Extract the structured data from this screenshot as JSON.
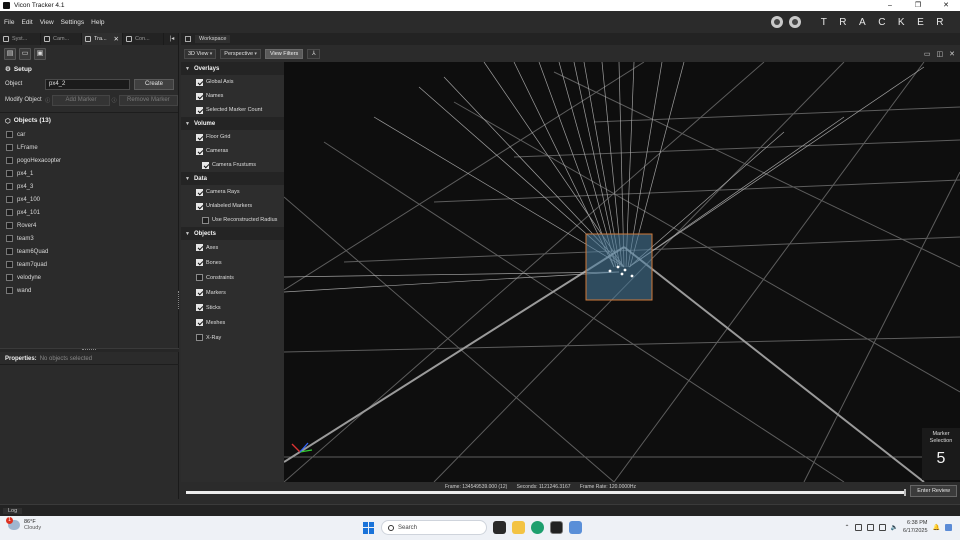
{
  "window": {
    "title": "Vicon Tracker 4.1",
    "minimize": "–",
    "maximize": "❐",
    "close": "✕"
  },
  "menu": [
    "File",
    "Edit",
    "View",
    "Settings",
    "Help"
  ],
  "brand": "TRACKER",
  "left_tabs": [
    {
      "label": "Syst...",
      "icon": "gear-icon"
    },
    {
      "label": "Cam...",
      "icon": "camera-icon"
    },
    {
      "label": "Tra...",
      "icon": "target-icon",
      "close": "✕"
    },
    {
      "label": "Con...",
      "icon": "wrench-icon"
    }
  ],
  "setup": {
    "title": "Setup",
    "object_label": "Object",
    "object_value": "px4_2",
    "create_label": "Create",
    "modify_label": "Modify Object",
    "add_marker": "Add Marker",
    "remove_marker": "Remove Marker"
  },
  "objects": {
    "title": "Objects (13)",
    "items": [
      "car",
      "LFrame",
      "pogoHexacopter",
      "px4_1",
      "px4_3",
      "px4_100",
      "px4_101",
      "Rover4",
      "team3",
      "team6Quad",
      "team7quad",
      "velodyne",
      "wand"
    ]
  },
  "properties": {
    "title": "Properties:",
    "subtitle": "No objects selected"
  },
  "workspace": {
    "tab": "Workspace",
    "view_mode": "3D View",
    "camera_mode": "Perspective",
    "view_filters": "View Filters"
  },
  "overlay_panel": {
    "sections": [
      {
        "title": "Overlays",
        "items": [
          {
            "label": "Global Axis",
            "checked": true
          },
          {
            "label": "Names",
            "checked": true
          },
          {
            "label": "Selected Marker Count",
            "checked": true
          }
        ]
      },
      {
        "title": "Volume",
        "items": [
          {
            "label": "Floor Grid",
            "checked": true
          },
          {
            "label": "Cameras",
            "checked": true
          },
          {
            "label": "Camera Frustums",
            "checked": true,
            "indent": true
          }
        ]
      },
      {
        "title": "Data",
        "items": [
          {
            "label": "Camera Rays",
            "checked": true
          },
          {
            "label": "Unlabeled Markers",
            "checked": true
          },
          {
            "label": "Use Reconstructed Radius",
            "checked": false,
            "indent": true
          }
        ]
      },
      {
        "title": "Objects",
        "items": [
          {
            "label": "Axes",
            "checked": true
          },
          {
            "label": "Bones",
            "checked": true
          },
          {
            "label": "Constraints",
            "checked": false
          },
          {
            "label": "Markers",
            "checked": true
          },
          {
            "label": "Sticks",
            "checked": true
          },
          {
            "label": "Meshes",
            "checked": true
          },
          {
            "label": "X-Ray",
            "checked": false
          }
        ]
      }
    ]
  },
  "marker_selection": {
    "label": "Marker Selection",
    "count": "5"
  },
  "status": {
    "frame": "Frame: 134549539.000 (12)",
    "seconds": "Seconds: 1121246.3167",
    "frame_rate": "Frame Rate: 120.0000Hz",
    "enter_review": "Enter Review"
  },
  "log_tab": "Log",
  "taskbar": {
    "temperature": "86°F",
    "weather": "Cloudy",
    "notification_count": "1",
    "search_placeholder": "Search",
    "time": "6:38 PM",
    "date": "6/17/2025"
  },
  "colors": {
    "accent": "#1a73d9",
    "panel": "#2b2b2b",
    "viewport": "#0e0e0e",
    "selection_box": "#4a7fa3"
  }
}
